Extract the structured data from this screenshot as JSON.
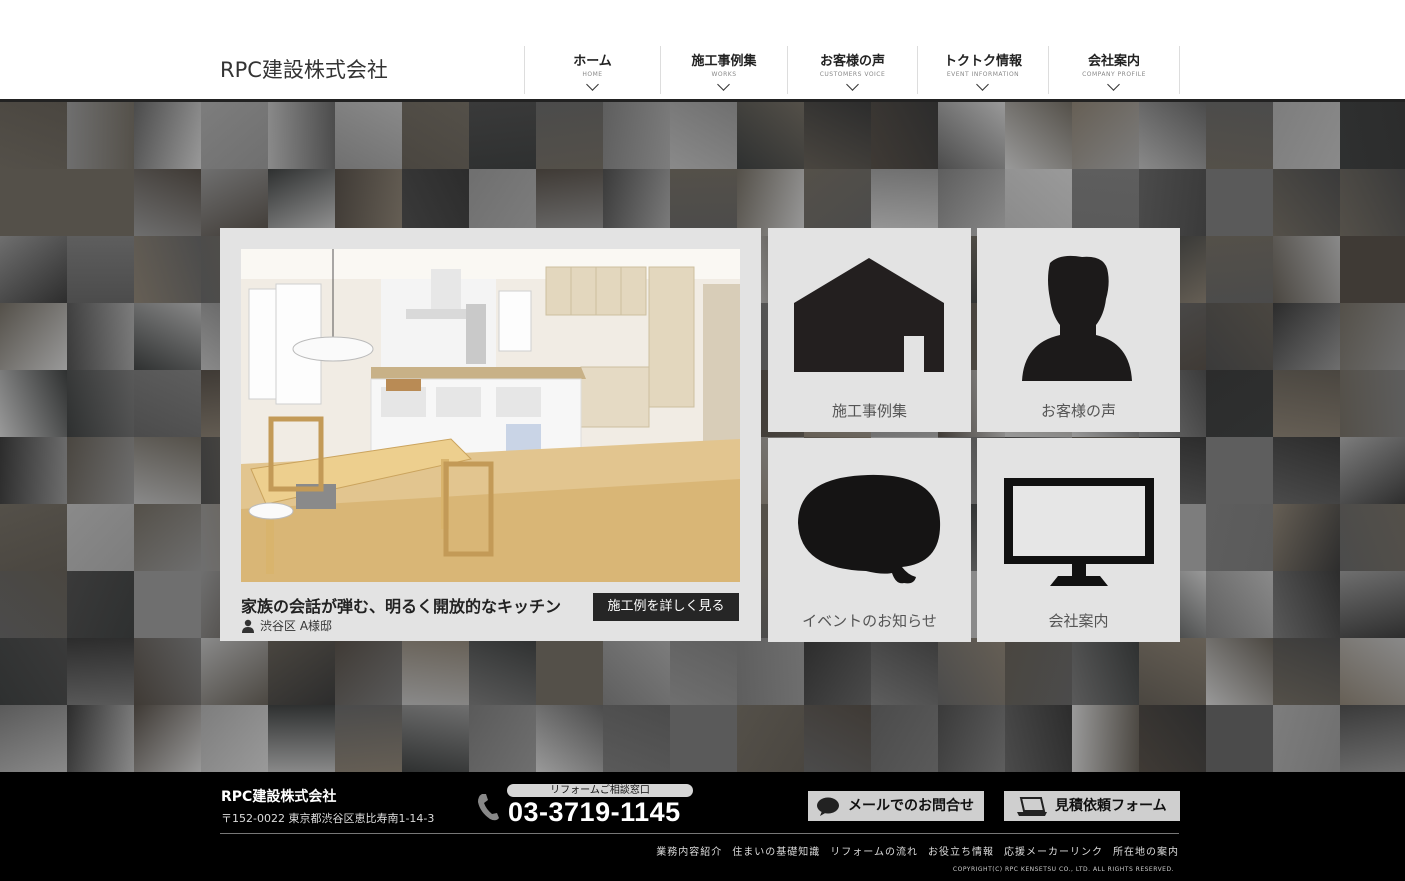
{
  "header": {
    "logo": "RPC建設株式会社",
    "nav": [
      {
        "label": "ホーム",
        "sub": "HOME"
      },
      {
        "label": "施工事例集",
        "sub": "WORKS"
      },
      {
        "label": "お客様の声",
        "sub": "CUSTOMERS VOICE"
      },
      {
        "label": "トクトク情報",
        "sub": "EVENT INFORMATION"
      },
      {
        "label": "会社案内",
        "sub": "COMPANY PROFILE"
      }
    ]
  },
  "feature": {
    "title": "家族の会話が弾む、明るく開放的なキッチン",
    "person": "渋谷区 A様邸",
    "button": "施工例を詳しく見る"
  },
  "tiles": [
    {
      "label": "施工事例集",
      "icon": "house-icon"
    },
    {
      "label": "お客様の声",
      "icon": "person-icon"
    },
    {
      "label": "イベントのお知らせ",
      "icon": "speech-bubble-icon"
    },
    {
      "label": "会社案内",
      "icon": "monitor-icon"
    }
  ],
  "footer": {
    "company": "RPC建設株式会社",
    "address": "〒152-0022 東京都渋谷区恵比寿南1-14-3",
    "window_label": "リフォームご相談窓口",
    "phone": "03-3719-1145",
    "mail_button": "メールでのお問合せ",
    "estimate_button": "見積依頼フォーム",
    "links": [
      "業務内容紹介",
      "住まいの基礎知識",
      "リフォームの流れ",
      "お役立ち情報",
      "応援メーカーリンク",
      "所在地の案内"
    ],
    "copyright": "COPYRIGHT(C) RPC KENSETSU CO., LTD. ALL RIGHTS RESERVED."
  }
}
